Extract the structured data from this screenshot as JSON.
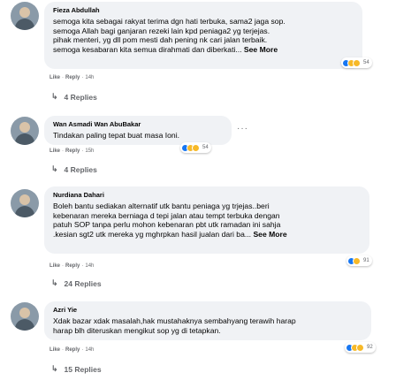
{
  "comments": [
    {
      "name": "Fieza Abdullah",
      "text": "semoga kita sebagai rakyat terima dgn hati terbuka, sama2 jaga sop.\nsemoga Allah bagi ganjaran rezeki lain kpd peniaga2 yg terjejas.\npihak menteri, yg dll pom mesti dah pening nk cari jalan terbaik.\nsemoga kesabaran kita semua dirahmati dan diberkati...",
      "see_more": "See More",
      "like": "Like",
      "reply": "Reply",
      "time": "14h",
      "reaction_count": "54",
      "replies": "4 Replies"
    },
    {
      "name": "Wan Asmadi Wan AbuBakar",
      "text": "Tindakan paling tepat buat masa Ioni.",
      "like": "Like",
      "reply": "Reply",
      "time": "15h",
      "reaction_count": "54",
      "replies": "4 Replies"
    },
    {
      "name": "Nurdiana Dahari",
      "text": "Boleh bantu sediakan alternatif utk bantu peniaga yg trjejas..beri\nkebenaran mereka berniaga d tepi jalan atau tempt terbuka dengan\npatuh SOP tanpa perlu mohon kebenaran pbt utk ramadan ini sahja\n.kesian sgt2 utk mereka yg mghrpkan hasil jualan dari ba...",
      "see_more": "See More",
      "like": "Like",
      "reply": "Reply",
      "time": "14h",
      "reaction_count": "91",
      "replies": "24 Replies"
    },
    {
      "name": "Azri Yie",
      "text": "Xdak bazar xdak masalah,hak mustahaknya sembahyang terawih harap\nharap blh diteruskan mengikut sop yg di tetapkan.",
      "like": "Like",
      "reply": "Reply",
      "time": "14h",
      "reaction_count": "92",
      "replies": "15 Replies"
    }
  ],
  "reply_arrow": "↳",
  "dot": "·",
  "more_dots": "···",
  "colors": {
    "bubble": "#f0f2f5",
    "meta": "#65676b",
    "like": "#1877f2",
    "emoji": "#f7b928"
  }
}
